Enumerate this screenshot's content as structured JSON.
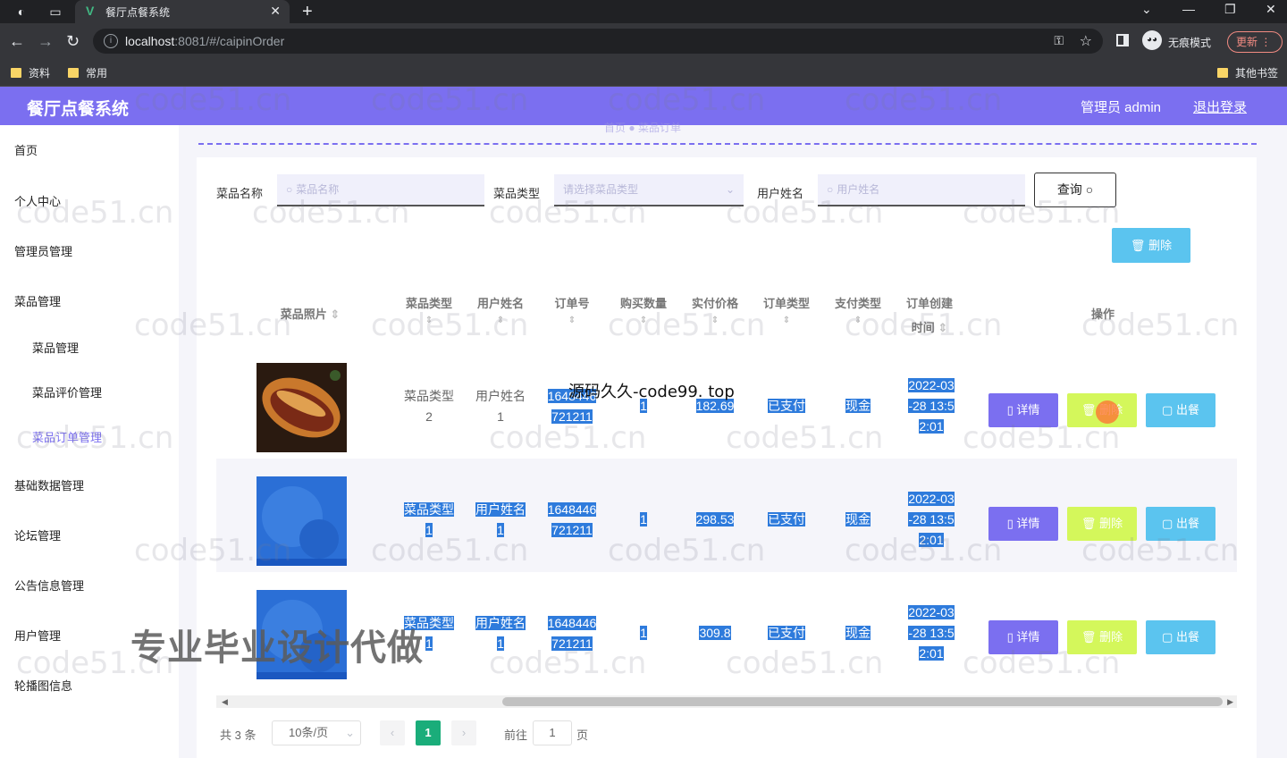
{
  "browser": {
    "tab_title": "餐厅点餐系统",
    "url_host": "localhost",
    "url_rest": ":8081/#/caipinOrder",
    "incognito_label": "无痕模式",
    "update_label": "更新",
    "bookmarks": [
      "资料",
      "常用",
      "其他书签"
    ]
  },
  "header": {
    "app_title": "餐厅点餐系统",
    "admin_label": "管理员 admin",
    "logout_label": "退出登录"
  },
  "sidebar": {
    "items": [
      {
        "label": "首页"
      },
      {
        "label": "个人中心"
      },
      {
        "label": "管理员管理"
      },
      {
        "label": "菜品管理"
      },
      {
        "label": "菜品管理"
      },
      {
        "label": "菜品评价管理"
      },
      {
        "label": "菜品订单管理"
      },
      {
        "label": "基础数据管理"
      },
      {
        "label": "论坛管理"
      },
      {
        "label": "公告信息管理"
      },
      {
        "label": "用户管理"
      },
      {
        "label": "轮播图信息"
      }
    ]
  },
  "breadcrumb": {
    "home": "首页",
    "current": "菜品订单"
  },
  "search": {
    "dish_name_label": "菜品名称",
    "dish_name_placeholder": "菜品名称",
    "dish_type_label": "菜品类型",
    "dish_type_placeholder": "请选择菜品类型",
    "user_name_label": "用户姓名",
    "user_name_placeholder": "用户姓名",
    "query_label": "查询"
  },
  "batch_delete_label": "删除",
  "table": {
    "headers": {
      "photo": "菜品照片",
      "type": "菜品类型",
      "user": "用户姓名",
      "order_no": "订单号",
      "qty": "购买数量",
      "price": "实付价格",
      "order_type": "订单类型",
      "pay_type": "支付类型",
      "created_a": "订单创建",
      "created_b": "时间",
      "actions": "操作"
    },
    "rows": [
      {
        "type_a": "菜品类型",
        "type_b": "2",
        "user_a": "用户姓名",
        "user_b": "1",
        "order_a": "1648446",
        "order_b": "721211",
        "qty": "1",
        "price": "182.69",
        "order_type": "已支付",
        "pay_type": "现金",
        "time_a": "2022-03",
        "time_b": "-28 13:5",
        "time_c": "2:01"
      },
      {
        "type_a": "菜品类型",
        "type_b": "1",
        "user_a": "用户姓名",
        "user_b": "1",
        "order_a": "1648446",
        "order_b": "721211",
        "qty": "1",
        "price": "298.53",
        "order_type": "已支付",
        "pay_type": "现金",
        "time_a": "2022-03",
        "time_b": "-28 13:5",
        "time_c": "2:01"
      },
      {
        "type_a": "菜品类型",
        "type_b": "1",
        "user_a": "用户姓名",
        "user_b": "1",
        "order_a": "1648446",
        "order_b": "721211",
        "qty": "1",
        "price": "309.8",
        "order_type": "已支付",
        "pay_type": "现金",
        "time_a": "2022-03",
        "time_b": "-28 13:5",
        "time_c": "2:01"
      }
    ],
    "action_labels": {
      "detail": "详情",
      "delete": "删除",
      "serve": "出餐"
    }
  },
  "pagination": {
    "total": "共 3 条",
    "page_size": "10条/页",
    "current_page": "1",
    "goto_label": "前往",
    "goto_value": "1",
    "page_unit": "页"
  },
  "overlays": {
    "source_text": "源码久久-code99. top",
    "promo_text": "专业毕业设计代做",
    "watermark": "code51.cn"
  },
  "colors": {
    "accent": "#7b6ff0",
    "detail": "#7b6ff0",
    "delete": "#d4f75b",
    "serve": "#5bc4ef",
    "selection": "#2e7bdc"
  }
}
